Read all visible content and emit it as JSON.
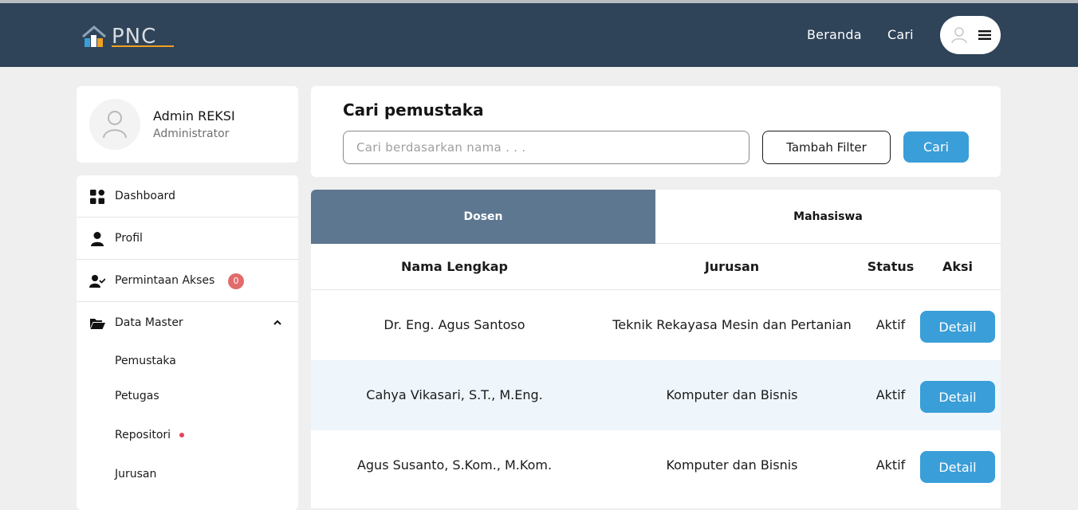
{
  "header": {
    "logo_text": "PNC",
    "nav": [
      {
        "label": "Beranda"
      },
      {
        "label": "Cari"
      }
    ]
  },
  "profile": {
    "name": "Admin REKSI",
    "role": "Administrator"
  },
  "sidebar": {
    "items": [
      {
        "label": "Dashboard",
        "icon": "dashboard-grid-icon"
      },
      {
        "label": "Profil",
        "icon": "user-icon"
      },
      {
        "label": "Permintaan Akses",
        "icon": "user-check-icon",
        "badge": "0"
      },
      {
        "label": "Data Master",
        "icon": "folder-open-icon",
        "expanded": true
      }
    ],
    "sub_items": [
      {
        "label": "Pemustaka"
      },
      {
        "label": "Petugas"
      },
      {
        "label": "Repositori",
        "has_dot": true
      },
      {
        "label": "Jurusan"
      }
    ]
  },
  "search": {
    "title": "Cari pemustaka",
    "placeholder": "Cari berdasarkan nama . . .",
    "filter_label": "Tambah Filter",
    "search_label": "Cari"
  },
  "tabs": [
    {
      "label": "Dosen",
      "active": true
    },
    {
      "label": "Mahasiswa",
      "active": false
    }
  ],
  "table": {
    "columns": [
      "Nama Lengkap",
      "Jurusan",
      "Status",
      "Aksi"
    ],
    "rows": [
      {
        "nama": "Dr. Eng. Agus Santoso",
        "jurusan": "Teknik Rekayasa Mesin dan Pertanian",
        "status": "Aktif",
        "aksi": "Detail"
      },
      {
        "nama": "Cahya Vikasari, S.T., M.Eng.",
        "jurusan": "Komputer dan Bisnis",
        "status": "Aktif",
        "aksi": "Detail"
      },
      {
        "nama": "Agus Susanto, S.Kom., M.Kom.",
        "jurusan": "Komputer dan Bisnis",
        "status": "Aktif",
        "aksi": "Detail"
      }
    ]
  },
  "colors": {
    "navbar": "#2f4359",
    "accent": "#3a9ed8",
    "active_tab": "#5d7791",
    "badge": "#e26b6b",
    "row_alt": "#eef6fb"
  }
}
